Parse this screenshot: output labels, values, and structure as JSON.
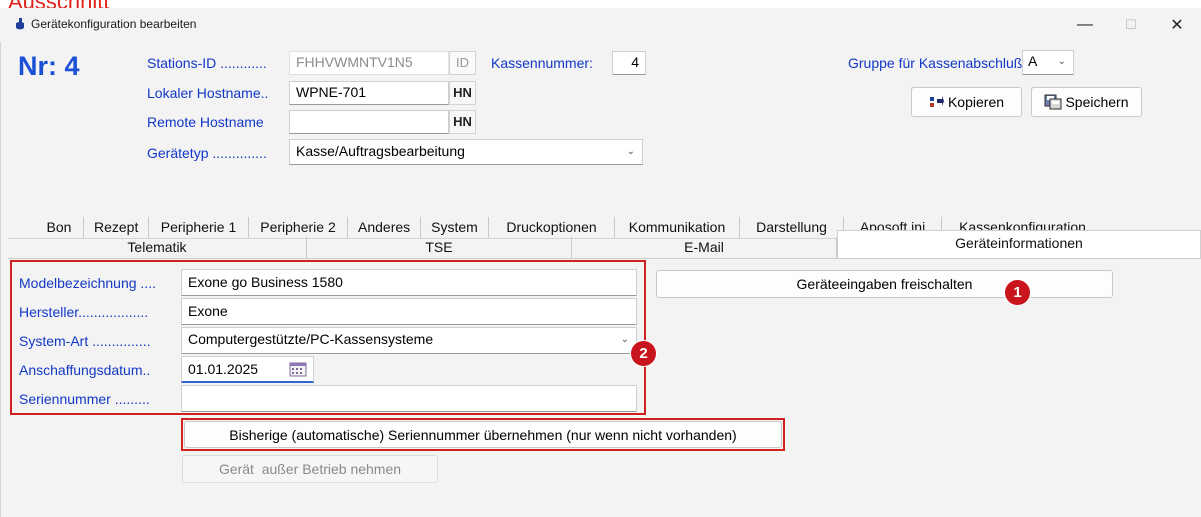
{
  "heading_fragment": "Ausschnitt",
  "window": {
    "title": "Gerätekonfiguration bearbeiten",
    "minimize": "—",
    "maximize": "☐",
    "close": "✕"
  },
  "device_number": "Nr: 4",
  "header": {
    "station_id_label": "Stations-ID",
    "station_id_dots": "............",
    "station_id_value": "FHHVWMNTV1N5",
    "station_id_suffix": "ID",
    "kassennummer_label": "Kassennummer:",
    "kassennummer_value": "4",
    "local_host_label": "Lokaler Hostname",
    "local_host_dots": "..",
    "local_host_value": "WPNE-701",
    "local_host_suffix": "HN",
    "remote_host_label": "Remote Hostname",
    "remote_host_value": "",
    "remote_host_suffix": "HN",
    "device_type_label": "Gerätetyp",
    "device_type_dots": "..............",
    "device_type_value": "Kasse/Auftragsbearbeitung",
    "group_label": "Gruppe für Kassenabschluß:",
    "group_value": "A",
    "copy_button": "Kopieren",
    "save_button": "Speichern"
  },
  "tabs_row1": [
    {
      "label": "Bon"
    },
    {
      "label": "Rezept"
    },
    {
      "label": "Peripherie 1"
    },
    {
      "label": "Peripherie 2"
    },
    {
      "label": "Anderes"
    },
    {
      "label": "System"
    },
    {
      "label": "Druckoptionen"
    },
    {
      "label": "Kommunikation"
    },
    {
      "label": "Darstellung"
    },
    {
      "label": "Aposoft.ini"
    },
    {
      "label": "Kassenkonfiguration"
    }
  ],
  "tabs_row2": [
    {
      "label": "Telematik"
    },
    {
      "label": "TSE"
    },
    {
      "label": "E-Mail"
    },
    {
      "label": "Geräteinformationen"
    }
  ],
  "form": {
    "model_label": "Modelbezeichnung",
    "model_dots": "....",
    "model_value": "Exone go Business 1580",
    "manufacturer_label": "Hersteller",
    "manufacturer_dots": "..................",
    "manufacturer_value": "Exone",
    "system_type_label": "System-Art",
    "system_type_dots": "...............",
    "system_type_value": "Computergestützte/PC-Kassensysteme",
    "purchase_date_label": "Anschaffungsdatum",
    "purchase_date_dots": "..",
    "purchase_date_value": "01.01.2025",
    "serial_label": "Seriennummer",
    "serial_dots": ".........",
    "serial_value": ""
  },
  "buttons": {
    "unlock_inputs": "Geräteeingaben freischalten",
    "adopt_serial": "Bisherige (automatische) Seriennummer übernehmen (nur wenn nicht vorhanden)",
    "decommission": "Gerät  außer Betrieb nehmen"
  },
  "badges": {
    "one": "1",
    "two": "2"
  },
  "colors": {
    "label_blue": "#1238c8",
    "number_blue": "#1a4fd6",
    "annotation_red": "#d21f1f",
    "badge_red": "#c8141c"
  }
}
